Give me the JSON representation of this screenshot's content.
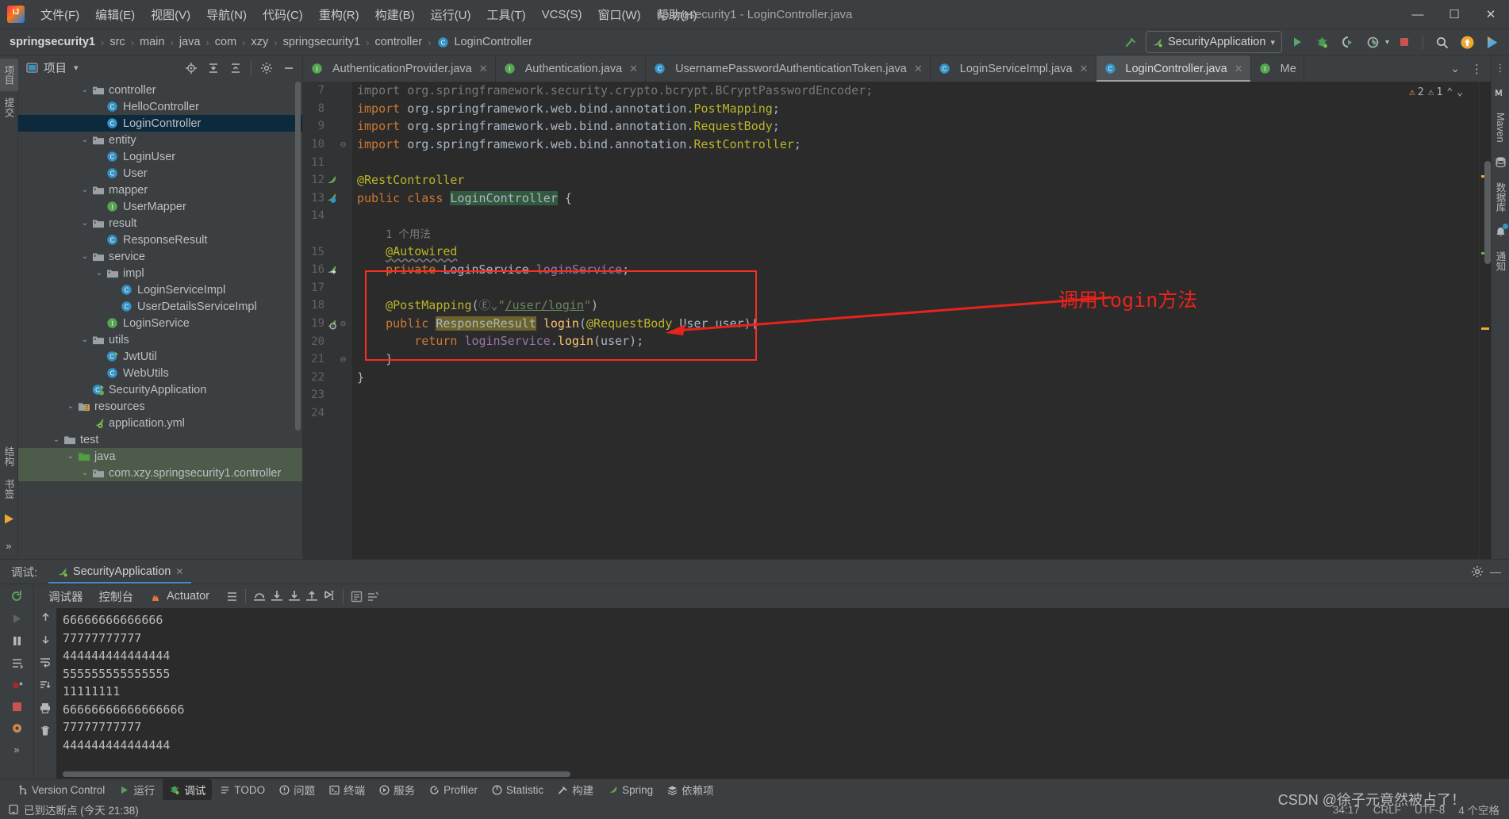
{
  "window": {
    "title": "springsecurity1 - LoginController.java",
    "minimize": "—",
    "maximize": "☐",
    "close": "✕"
  },
  "menu": {
    "items": [
      {
        "label": "文件(F)"
      },
      {
        "label": "编辑(E)"
      },
      {
        "label": "视图(V)"
      },
      {
        "label": "导航(N)"
      },
      {
        "label": "代码(C)"
      },
      {
        "label": "重构(R)"
      },
      {
        "label": "构建(B)"
      },
      {
        "label": "运行(U)"
      },
      {
        "label": "工具(T)"
      },
      {
        "label": "VCS(S)"
      },
      {
        "label": "窗口(W)"
      },
      {
        "label": "帮助(H)"
      }
    ]
  },
  "breadcrumb": {
    "items": [
      "springsecurity1",
      "src",
      "main",
      "java",
      "com",
      "xzy",
      "springsecurity1",
      "controller",
      "LoginController"
    ],
    "separator": "›"
  },
  "run_toolbar": {
    "config_name": "SecurityApplication",
    "dropdown_caret": "▾",
    "buttons": [
      "run-icon",
      "debug-icon",
      "run-coverage-icon",
      "profiler-icon",
      "stop-icon",
      "search-everywhere-icon",
      "updates-icon",
      "ide-assistant-icon"
    ]
  },
  "left_rail": {
    "tabs": [
      {
        "label": "项目",
        "selected": true
      },
      {
        "label": "提交"
      }
    ],
    "bottom": [
      {
        "label": "结构"
      },
      {
        "label": "书签"
      }
    ]
  },
  "project_panel": {
    "title": "项目",
    "caret": "▾",
    "header_icons": [
      "locate-icon",
      "expand-all-icon",
      "collapse-all-icon",
      "settings-icon",
      "hide-icon"
    ],
    "tree": [
      {
        "label": "controller",
        "indent": 4,
        "arrow": "⌄",
        "icon": "package-folder",
        "state": "normal"
      },
      {
        "label": "HelloController",
        "indent": 5,
        "arrow": "",
        "icon": "class",
        "state": "normal"
      },
      {
        "label": "LoginController",
        "indent": 5,
        "arrow": "",
        "icon": "class",
        "state": "selected"
      },
      {
        "label": "entity",
        "indent": 4,
        "arrow": "⌄",
        "icon": "package-folder",
        "state": "normal"
      },
      {
        "label": "LoginUser",
        "indent": 5,
        "arrow": "",
        "icon": "class",
        "state": "normal"
      },
      {
        "label": "User",
        "indent": 5,
        "arrow": "",
        "icon": "class",
        "state": "normal"
      },
      {
        "label": "mapper",
        "indent": 4,
        "arrow": "⌄",
        "icon": "package-folder",
        "state": "normal"
      },
      {
        "label": "UserMapper",
        "indent": 5,
        "arrow": "",
        "icon": "interface",
        "state": "normal"
      },
      {
        "label": "result",
        "indent": 4,
        "arrow": "⌄",
        "icon": "package-folder",
        "state": "normal"
      },
      {
        "label": "ResponseResult",
        "indent": 5,
        "arrow": "",
        "icon": "class",
        "state": "normal"
      },
      {
        "label": "service",
        "indent": 4,
        "arrow": "⌄",
        "icon": "package-folder",
        "state": "normal"
      },
      {
        "label": "impl",
        "indent": 5,
        "arrow": "⌄",
        "icon": "package-folder",
        "state": "normal"
      },
      {
        "label": "LoginServiceImpl",
        "indent": 6,
        "arrow": "",
        "icon": "class",
        "state": "normal"
      },
      {
        "label": "UserDetailsServiceImpl",
        "indent": 6,
        "arrow": "",
        "icon": "class",
        "state": "normal"
      },
      {
        "label": "LoginService",
        "indent": 5,
        "arrow": "",
        "icon": "interface",
        "state": "normal"
      },
      {
        "label": "utils",
        "indent": 4,
        "arrow": "⌄",
        "icon": "package-folder",
        "state": "normal"
      },
      {
        "label": "JwtUtil",
        "indent": 5,
        "arrow": "",
        "icon": "class-run",
        "state": "normal"
      },
      {
        "label": "WebUtils",
        "indent": 5,
        "arrow": "",
        "icon": "class",
        "state": "normal"
      },
      {
        "label": "SecurityApplication",
        "indent": 4,
        "arrow": "",
        "icon": "spring-class",
        "state": "normal"
      },
      {
        "label": "resources",
        "indent": 3,
        "arrow": "⌄",
        "icon": "resource-folder",
        "state": "normal"
      },
      {
        "label": "application.yml",
        "indent": 4,
        "arrow": "",
        "icon": "spring-yml",
        "state": "normal"
      },
      {
        "label": "test",
        "indent": 2,
        "arrow": "⌄",
        "icon": "folder",
        "state": "normal"
      },
      {
        "label": "java",
        "indent": 3,
        "arrow": "⌄",
        "icon": "test-source-folder",
        "state": "green"
      },
      {
        "label": "com.xzy.springsecurity1.controller",
        "indent": 4,
        "arrow": "⌄",
        "icon": "package-folder",
        "state": "green"
      }
    ]
  },
  "editor": {
    "tabs": [
      {
        "label": "AuthenticationProvider.java",
        "icon": "interface",
        "active": false,
        "close": "✕"
      },
      {
        "label": "Authentication.java",
        "icon": "interface",
        "active": false,
        "close": "✕"
      },
      {
        "label": "UsernamePasswordAuthenticationToken.java",
        "icon": "class",
        "active": false,
        "close": "✕"
      },
      {
        "label": "LoginServiceImpl.java",
        "icon": "class",
        "active": false,
        "close": "✕"
      },
      {
        "label": "LoginController.java",
        "icon": "class",
        "active": true,
        "close": "✕"
      },
      {
        "label": "Me",
        "icon": "interface",
        "active": false,
        "close": ""
      }
    ],
    "tab_overflow_caret": "⌄",
    "tab_menu": "⋮",
    "inspection": {
      "warnings": "2",
      "weak_warnings": "1",
      "warning_glyph": "⚠",
      "up": "⌃",
      "down": "⌄"
    },
    "lines": [
      {
        "num": "7",
        "marker": "",
        "fold": "",
        "code_html": "<span class=\"dim\">import org.springframework.security.crypto.bcrypt.BCryptPasswordEncoder;</span>"
      },
      {
        "num": "8",
        "marker": "",
        "fold": "",
        "code_html": "<span class=\"kw\">import</span> org.springframework.web.bind.annotation.<span class=\"anno\">PostMapping</span>;"
      },
      {
        "num": "9",
        "marker": "",
        "fold": "",
        "code_html": "<span class=\"kw\">import</span> org.springframework.web.bind.annotation.<span class=\"anno\">RequestBody</span>;"
      },
      {
        "num": "10",
        "marker": "",
        "fold": "⊖",
        "code_html": "<span class=\"kw\">import</span> org.springframework.web.bind.annotation.<span class=\"anno\">RestController</span>;"
      },
      {
        "num": "11",
        "marker": "",
        "fold": "",
        "code_html": ""
      },
      {
        "num": "12",
        "marker": "bean",
        "fold": "",
        "code_html": "<span class=\"anno\">@RestController</span>"
      },
      {
        "num": "13",
        "marker": "bean-class",
        "fold": "",
        "code_html": "<span class=\"kw\">public class</span> <span class=\"hl-green\">LoginController</span> {"
      },
      {
        "num": "14",
        "marker": "",
        "fold": "",
        "code_html": ""
      },
      {
        "num": "",
        "marker": "",
        "fold": "",
        "code_html": "    <span class=\"hint\">1 个用法</span>"
      },
      {
        "num": "15",
        "marker": "",
        "fold": "",
        "code_html": "    <span class=\"anno squig\">@Autowired</span>"
      },
      {
        "num": "16",
        "marker": "bean-arrow",
        "fold": "",
        "code_html": "    <span class=\"kw\">private</span> LoginService <span class=\"fld\">loginService</span>;"
      },
      {
        "num": "17",
        "marker": "",
        "fold": "",
        "code_html": ""
      },
      {
        "num": "18",
        "marker": "",
        "fold": "",
        "code_html": "    <span class=\"anno\">@PostMapping</span>(<span class=\"dim\">Ⓔ⌄</span><span class=\"str\">\"</span><span class=\"url\">/user/login</span><span class=\"str\">\"</span>)"
      },
      {
        "num": "19",
        "marker": "bean-web",
        "fold": "⊖",
        "code_html": "    <span class=\"kw\">public</span> <span class=\"hl-olive\">ResponseResult</span> <span class=\"mtd\">login</span>(<span class=\"anno\">@RequestBody</span> User user){"
      },
      {
        "num": "20",
        "marker": "",
        "fold": "",
        "code_html": "        <span class=\"kw\">return</span> <span class=\"fld\">loginService</span>.<span class=\"mtd\">login</span>(user);"
      },
      {
        "num": "21",
        "marker": "",
        "fold": "⊖",
        "code_html": "    }"
      },
      {
        "num": "22",
        "marker": "",
        "fold": "",
        "code_html": "}"
      },
      {
        "num": "23",
        "marker": "",
        "fold": "",
        "code_html": ""
      },
      {
        "num": "24",
        "marker": "",
        "fold": "",
        "code_html": ""
      }
    ],
    "annotation": {
      "text": "调用login方法",
      "color": "#e8231c"
    }
  },
  "right_rail": {
    "items": [
      {
        "label": "Maven",
        "icon": "maven-icon"
      },
      {
        "label": "数据库",
        "icon": "database-icon"
      },
      {
        "label": "通知",
        "icon": "bell-icon"
      }
    ]
  },
  "debug_panel": {
    "key": "调试:",
    "session_tab": "SecurityApplication",
    "session_close": "✕",
    "settings_icon": "gear-icon",
    "minimize_icon": "—",
    "tabs": [
      {
        "label": "调试器",
        "selected": false
      },
      {
        "label": "控制台",
        "selected": true
      },
      {
        "label": "Actuator",
        "selected": false
      }
    ],
    "toolbar_icons": [
      "layout-icon",
      "step-over-icon",
      "step-into-icon",
      "force-step-into-icon",
      "step-out-icon",
      "run-to-cursor-icon",
      "evaluate-icon",
      "mute-breakpoints-icon"
    ],
    "side_icons": [
      "rerun-icon",
      "resume-icon",
      "pause-icon",
      "stop-icon",
      "view-breakpoints-icon",
      "mute-breakpoints-icon",
      "settings2-icon",
      "expand-icon"
    ],
    "console_side_icons": [
      "scroll-up-icon",
      "scroll-down-icon",
      "soft-wrap-icon",
      "scroll-to-end-icon",
      "print-icon",
      "trash-icon"
    ],
    "console_lines": [
      "66666666666666",
      "77777777777",
      "444444444444444",
      "555555555555555",
      "11111111",
      "66666666666666666",
      "77777777777",
      "444444444444444"
    ]
  },
  "status": {
    "tool_buttons": [
      {
        "label": "Version Control",
        "icon": "branch-icon",
        "selected": false
      },
      {
        "label": "运行",
        "icon": "run-icon",
        "selected": false
      },
      {
        "label": "调试",
        "icon": "debug-icon",
        "selected": true
      },
      {
        "label": "TODO",
        "icon": "todo-icon",
        "selected": false
      },
      {
        "label": "问题",
        "icon": "problems-icon",
        "selected": false
      },
      {
        "label": "终端",
        "icon": "terminal-icon",
        "selected": false
      },
      {
        "label": "服务",
        "icon": "services-icon",
        "selected": false
      },
      {
        "label": "Profiler",
        "icon": "profiler-icon",
        "selected": false
      },
      {
        "label": "Statistic",
        "icon": "statistic-icon",
        "selected": false
      },
      {
        "label": "构建",
        "icon": "build-icon",
        "selected": false
      },
      {
        "label": "Spring",
        "icon": "spring-icon",
        "selected": false
      },
      {
        "label": "依赖项",
        "icon": "dependencies-icon",
        "selected": false
      }
    ],
    "message": "已到达断点 (今天 21:38)",
    "message_icon": "terminal-small-icon",
    "right": [
      "34:17",
      "CRLF",
      "UTF-8",
      "4 个空格"
    ],
    "watermark": "CSDN @徐子元竟然被占了！"
  }
}
